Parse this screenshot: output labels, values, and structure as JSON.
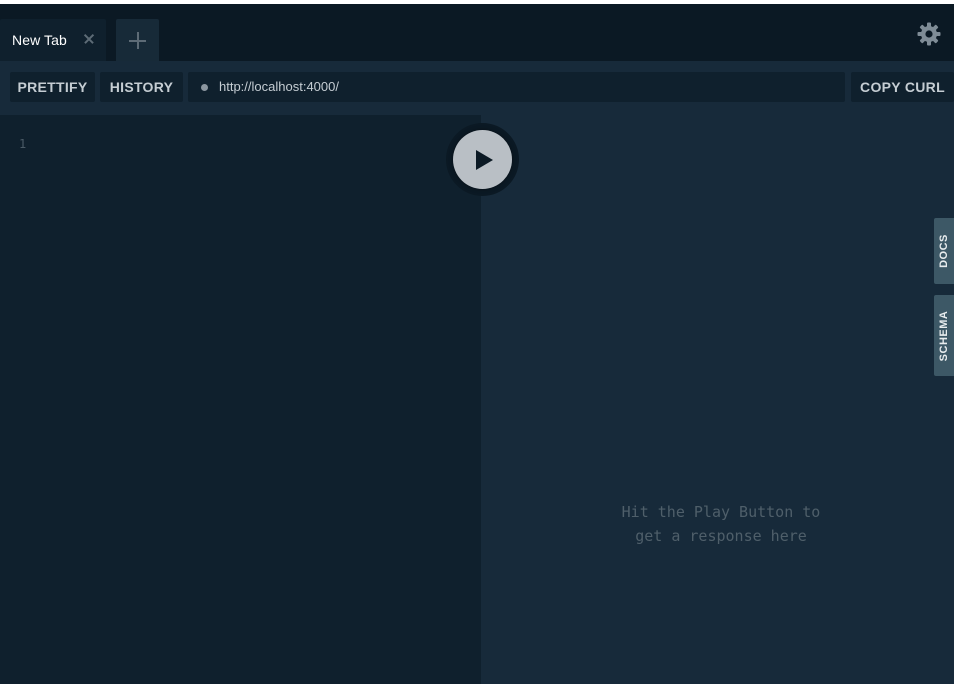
{
  "tabs": [
    {
      "label": "New Tab"
    }
  ],
  "toolbar": {
    "prettify_label": "PRETTIFY",
    "history_label": "HISTORY",
    "endpoint_url": "http://localhost:4000/",
    "copy_curl_label": "COPY CURL"
  },
  "editor": {
    "line_numbers": [
      "1"
    ]
  },
  "result": {
    "placeholder": "Hit the Play Button to\nget a response here"
  },
  "side_tabs": {
    "docs_label": "DOCS",
    "schema_label": "SCHEMA"
  },
  "icons": {
    "tab_close": "close-icon",
    "new_tab": "plus-icon",
    "settings": "gear-icon",
    "play": "play-icon",
    "status": "status-dot-icon"
  },
  "colors": {
    "background": "#0f202d",
    "panel": "#172a3a",
    "tabbar": "#0b1924",
    "side_tab": "#3d5866",
    "play_button": "#b9bfc5"
  }
}
